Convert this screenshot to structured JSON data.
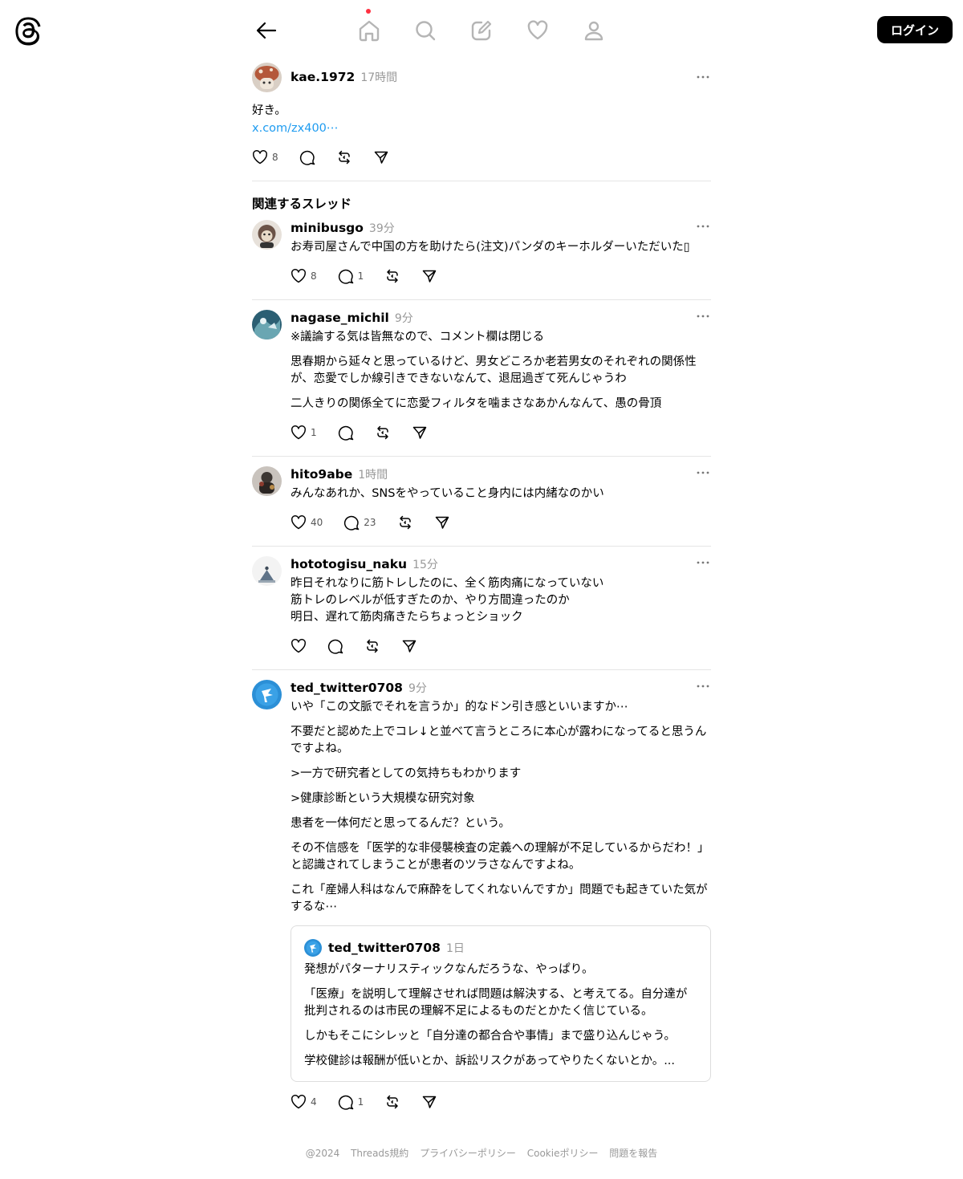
{
  "header": {
    "login_label": "ログイン"
  },
  "nav": [
    "back-arrow-icon",
    "home-icon",
    "search-icon",
    "compose-icon",
    "heart-icon",
    "profile-icon"
  ],
  "main_post": {
    "username": "kae.1972",
    "time": "17時間",
    "text": "好き。",
    "link": "x.com/zx400⋯",
    "likes": "8"
  },
  "related_title": "関連するスレッド",
  "threads": [
    {
      "username": "minibusgo",
      "time": "39分",
      "paragraphs": [
        "お寿司屋さんで中国の方を助けたら(注文)パンダのキーホルダーいただいた▯"
      ],
      "likes": "8",
      "replies": "1"
    },
    {
      "username": "nagase_michil",
      "time": "9分",
      "paragraphs": [
        "※議論する気は皆無なので、コメント欄は閉じる",
        "思春期から延々と思っているけど、男女どころか老若男女のそれぞれの関係性が、恋愛でしか線引きできないなんて、退屈過ぎて死んじゃうわ",
        "二人きりの関係全てに恋愛フィルタを噛まさなあかんなんて、愚の骨頂"
      ],
      "likes": "1",
      "replies": ""
    },
    {
      "username": "hito9abe",
      "time": "1時間",
      "paragraphs": [
        "みんなあれか、SNSをやっていること身内には内緒なのかい"
      ],
      "likes": "40",
      "replies": "23"
    },
    {
      "username": "hototogisu_naku",
      "time": "15分",
      "paragraphs": [
        "昨日それなりに筋トレしたのに、全く筋肉痛になっていない",
        "筋トレのレベルが低すぎたのか、やり方間違ったのか",
        "明日、遅れて筋肉痛きたらちょっとショック"
      ],
      "likes": "",
      "replies": ""
    },
    {
      "username": "ted_twitter0708",
      "time": "9分",
      "paragraphs": [
        "いや「この文脈でそれを言うか」的なドン引き感といいますか⋯",
        "不要だと認めた上でコレ↓と並べて言うところに本心が露わになってると思うんですよね。",
        ">一方で研究者としての気持ちもわかります",
        ">健康診断という大規模な研究対象",
        "患者を一体何だと思ってるんだ？という。",
        "その不信感を「医学的な非侵襲検査の定義への理解が不足しているからだわ！」と認識されてしまうことが患者のツラさなんですよね。",
        "これ「産婦人科はなんで麻酔をしてくれないんですか」問題でも起きていた気がするな⋯"
      ],
      "likes": "4",
      "replies": "1",
      "quote": {
        "username": "ted_twitter0708",
        "time": "1日",
        "paragraphs": [
          "発想がパターナリスティックなんだろうな、やっぱり。",
          "「医療」を説明して理解させれば問題は解決する、と考えてる。自分達が批判されるのは市民の理解不足によるものだとかたく信じている。",
          "しかもそこにシレッと「自分達の都合合や事情」まで盛り込んじゃう。",
          "学校健診は報酬が低いとか、訴訟リスクがあってやりたくないとか。..."
        ]
      }
    }
  ],
  "footer": [
    "@2024",
    "Threads規約",
    "プライバシーポリシー",
    "Cookieポリシー",
    "問題を報告"
  ],
  "colors": {
    "link": "#1d9bf0",
    "dot": "#ff3040",
    "muted": "#999999"
  }
}
